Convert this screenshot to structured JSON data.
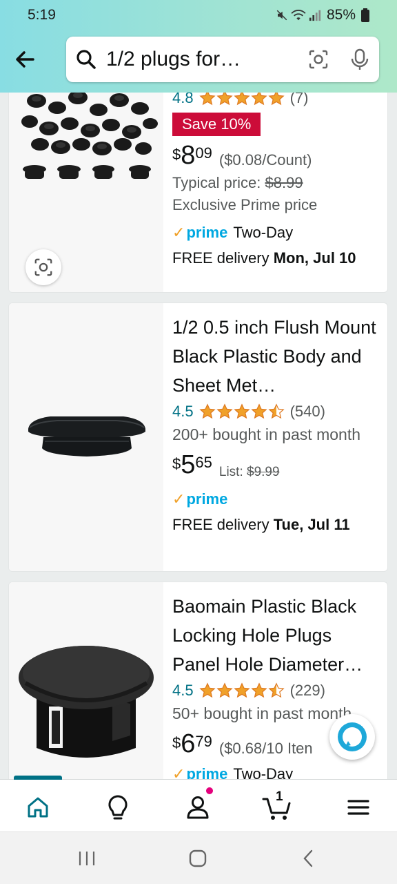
{
  "status": {
    "time": "5:19",
    "battery": "85%"
  },
  "search": {
    "query": "1/2 plugs for…"
  },
  "results": [
    {
      "rating": "4.8",
      "stars": 5,
      "rating_count": "(7)",
      "badge": "Save 10%",
      "price_currency": "$",
      "price_whole": "8",
      "price_fraction": "09",
      "price_unit": "($0.08/Count)",
      "typical_label": "Typical price: ",
      "typical_price": "$8.99",
      "exclusive": "Exclusive Prime price",
      "prime_label": "prime",
      "prime_extra": "Two-Day",
      "delivery_prefix": "FREE delivery ",
      "delivery_date": "Mon, Jul 10"
    },
    {
      "title": "1/2 0.5 inch Flush Mount Black Plastic Body and Sheet Met…",
      "rating": "4.5",
      "stars": 4.5,
      "rating_count": "(540)",
      "bought": "200+ bought in past month",
      "price_currency": "$",
      "price_whole": "5",
      "price_fraction": "65",
      "list_label": "List: ",
      "list_price": "$9.99",
      "prime_label": "prime",
      "delivery_prefix": "FREE delivery ",
      "delivery_date": "Tue, Jul 11"
    },
    {
      "title": "Baomain Plastic Black Locking Hole Plugs Panel Hole Diameter…",
      "rating": "4.5",
      "stars": 4.5,
      "rating_count": "(229)",
      "bought": "50+ bought in past month",
      "price_currency": "$",
      "price_whole": "6",
      "price_fraction": "79",
      "price_unit": "($0.68/10 Iten",
      "prime_label": "prime",
      "prime_extra": "Two-Day"
    }
  ],
  "bottom_nav": {
    "cart_count": "1"
  },
  "colors": {
    "accent": "#007185",
    "prime_blue": "#00a8e1",
    "star": "#f0a12a",
    "badge_red": "#cc0c39"
  }
}
